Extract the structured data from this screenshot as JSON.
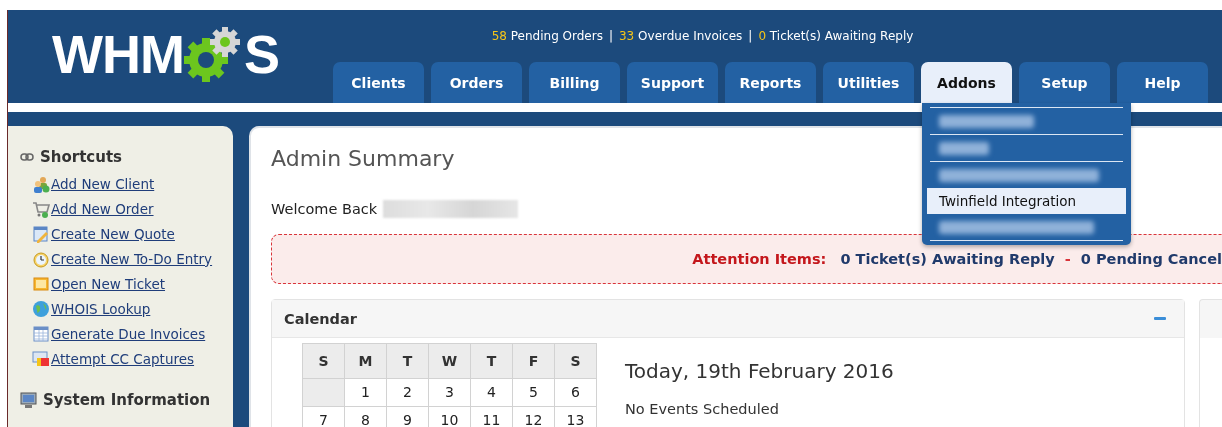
{
  "logo": {
    "text_before": "WHM",
    "text_after": "S"
  },
  "stats": [
    {
      "count": "58",
      "label": "Pending Orders"
    },
    {
      "count": "33",
      "label": "Overdue Invoices"
    },
    {
      "count": "0",
      "label": "Ticket(s) Awaiting Reply"
    }
  ],
  "stats_separator": "|",
  "tabs": [
    {
      "label": "Clients",
      "selected": false
    },
    {
      "label": "Orders",
      "selected": false
    },
    {
      "label": "Billing",
      "selected": false
    },
    {
      "label": "Support",
      "selected": false
    },
    {
      "label": "Reports",
      "selected": false
    },
    {
      "label": "Utilities",
      "selected": false
    },
    {
      "label": "Addons",
      "selected": true
    },
    {
      "label": "Setup",
      "selected": false
    },
    {
      "label": "Help",
      "selected": false
    }
  ],
  "addons_menu": [
    {
      "kind": "blurred",
      "selected": false
    },
    {
      "kind": "blurred",
      "selected": false
    },
    {
      "kind": "blurred",
      "selected": false
    },
    {
      "kind": "item",
      "label": "Twinfield Integration",
      "selected": true
    },
    {
      "kind": "blurred",
      "selected": false
    }
  ],
  "sidebar": {
    "title": "Shortcuts",
    "items": [
      {
        "label": "Add New Client"
      },
      {
        "label": "Add New Order"
      },
      {
        "label": "Create New Quote"
      },
      {
        "label": "Create New To-Do Entry"
      },
      {
        "label": "Open New Ticket"
      },
      {
        "label": "WHOIS Lookup"
      },
      {
        "label": "Generate Due Invoices"
      },
      {
        "label": "Attempt CC Captures"
      }
    ],
    "next_title": "System Information"
  },
  "main": {
    "title": "Admin Summary",
    "welcome": "Welcome Back",
    "attention": {
      "label": "Attention Items:",
      "items": [
        "0 Ticket(s) Awaiting Reply",
        "0 Pending Cancel"
      ],
      "separator": "-"
    },
    "calendar": {
      "title": "Calendar",
      "weekdays": [
        "S",
        "M",
        "T",
        "W",
        "T",
        "F",
        "S"
      ],
      "weeks": [
        [
          {
            "kind": "blank"
          },
          {
            "kind": "day",
            "text": "1"
          },
          {
            "kind": "day",
            "text": "2"
          },
          {
            "kind": "day",
            "text": "3"
          },
          {
            "kind": "day",
            "text": "4"
          },
          {
            "kind": "day",
            "text": "5"
          },
          {
            "kind": "day",
            "text": "6"
          }
        ],
        [
          {
            "kind": "day",
            "text": "7"
          },
          {
            "kind": "day",
            "text": "8"
          },
          {
            "kind": "day",
            "text": "9"
          },
          {
            "kind": "day",
            "text": "10"
          },
          {
            "kind": "day",
            "text": "11"
          },
          {
            "kind": "day",
            "text": "12"
          },
          {
            "kind": "day",
            "text": "13"
          }
        ]
      ],
      "today": "Today, 19th February 2016",
      "events": "No Events Scheduled"
    }
  }
}
